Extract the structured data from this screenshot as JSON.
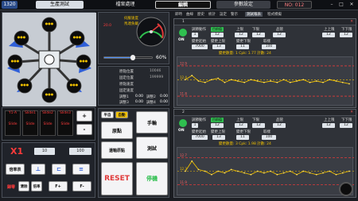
{
  "topbar": {
    "counter": "1320",
    "tab_production": "生產測試",
    "tab_files": "檔案處理",
    "tab_edit": "編輯",
    "tab_params": "參數設定",
    "program_no": "NO: 012",
    "window_min": "–",
    "window_max": "□",
    "window_close": "✕"
  },
  "servo_panel": {
    "axis_labels": [
      "Y1-A",
      "Slide1",
      "Slide2",
      "Slide3"
    ],
    "slide_labels": [
      "Slide",
      "Slide",
      "Slide",
      "Slide"
    ],
    "plus": "+",
    "minus": "-"
  },
  "jog": {
    "axis": "X1",
    "step": "10",
    "speed": "100",
    "rate_table": "倍率表",
    "clear": "清除",
    "rate": "倍率",
    "f_plus": "F+",
    "f_minus": "F-",
    "reset_label": "歸零"
  },
  "gauge": {
    "title1": "伺服速度",
    "title2": "馬達負載",
    "needle_value": "20.0",
    "slider_percent": 60,
    "slider_text": "60%"
  },
  "readouts": [
    {
      "label": "原點位置",
      "value": "10046"
    },
    {
      "label": "固定位置",
      "value": "199999"
    },
    {
      "label": "原點速度",
      "value": ""
    },
    {
      "label": "固定速度",
      "value": ""
    }
  ],
  "small_readouts": [
    {
      "label": "調整1",
      "value": "0.00",
      "label2": "調整2",
      "value2": "0.00"
    },
    {
      "label": "調整3",
      "value": "0.00",
      "label2": "調整4",
      "value2": "0.00"
    }
  ],
  "controls": {
    "mode_a": "半自",
    "mode_b": "自動",
    "origin": "原點",
    "manual": "手輪",
    "return_origin": "還軸原點",
    "test": "測試",
    "reset": "RESET",
    "stop": "停機"
  },
  "monitor_tabs": [
    "即時",
    "曲線",
    "歷史",
    "統計",
    "設定",
    "警示",
    "測試報表",
    "程式模擬"
  ],
  "monitors": [
    {
      "index": "1",
      "state": "ON",
      "headers": [
        "調節動作",
        "目前值",
        "上限",
        "下限",
        "品管",
        "上上限",
        "下下限"
      ],
      "row1": [
        "1",
        "12",
        "12",
        "12",
        "12",
        "12",
        "12"
      ],
      "row2_labels": [
        "變更起始",
        "變更上限",
        "變更下限",
        "取樣"
      ],
      "row2": [
        "7000",
        "13",
        "11",
        "100"
      ],
      "status": "變更數量: 1  Cpk: 1.77  計數: 24",
      "cpk": "1.77",
      "count": "24",
      "avg": "12.4",
      "upper": "12.9",
      "lower": "11.8",
      "series": [
        12.4,
        12.55,
        12.35,
        12.3,
        12.4,
        12.45,
        12.3,
        12.4,
        12.35,
        12.3,
        12.4,
        12.35,
        12.3,
        12.35,
        12.3,
        12.4,
        12.3,
        12.35,
        12.4,
        12.3,
        12.35,
        12.3,
        12.4,
        12.35,
        12.3,
        12.25
      ]
    },
    {
      "index": "2",
      "state": "ON",
      "headers": [
        "調節動作",
        "目前值",
        "上限",
        "下限",
        "品管",
        "上上限",
        "下下限"
      ],
      "row1": [
        "1",
        "12",
        "12",
        "12",
        "12",
        "12",
        "12"
      ],
      "row2_labels": [
        "變更起始",
        "變更上限",
        "變更下限",
        "取樣"
      ],
      "row2": [
        "7000",
        "13",
        "11",
        "100"
      ],
      "status": "變更數量: 3  Cpk: 1.98  計數: 24",
      "cpk": "1.98",
      "count": "24",
      "avg": "12.3",
      "upper": "12.7",
      "lower": "11.9",
      "series": [
        12.3,
        12.6,
        12.35,
        12.3,
        12.2,
        12.3,
        12.25,
        12.35,
        12.3,
        12.25,
        12.2,
        12.3,
        12.25,
        12.3,
        12.2,
        12.25,
        12.3,
        12.2,
        12.3,
        12.25,
        12.2,
        12.25,
        12.3,
        12.2,
        12.25,
        12.3
      ]
    }
  ],
  "colors": {
    "accent": "#f0c000",
    "red": "#e03a3a",
    "green": "#2fbf4f",
    "blue": "#2f5fd8",
    "panel": "#2a2d33"
  }
}
